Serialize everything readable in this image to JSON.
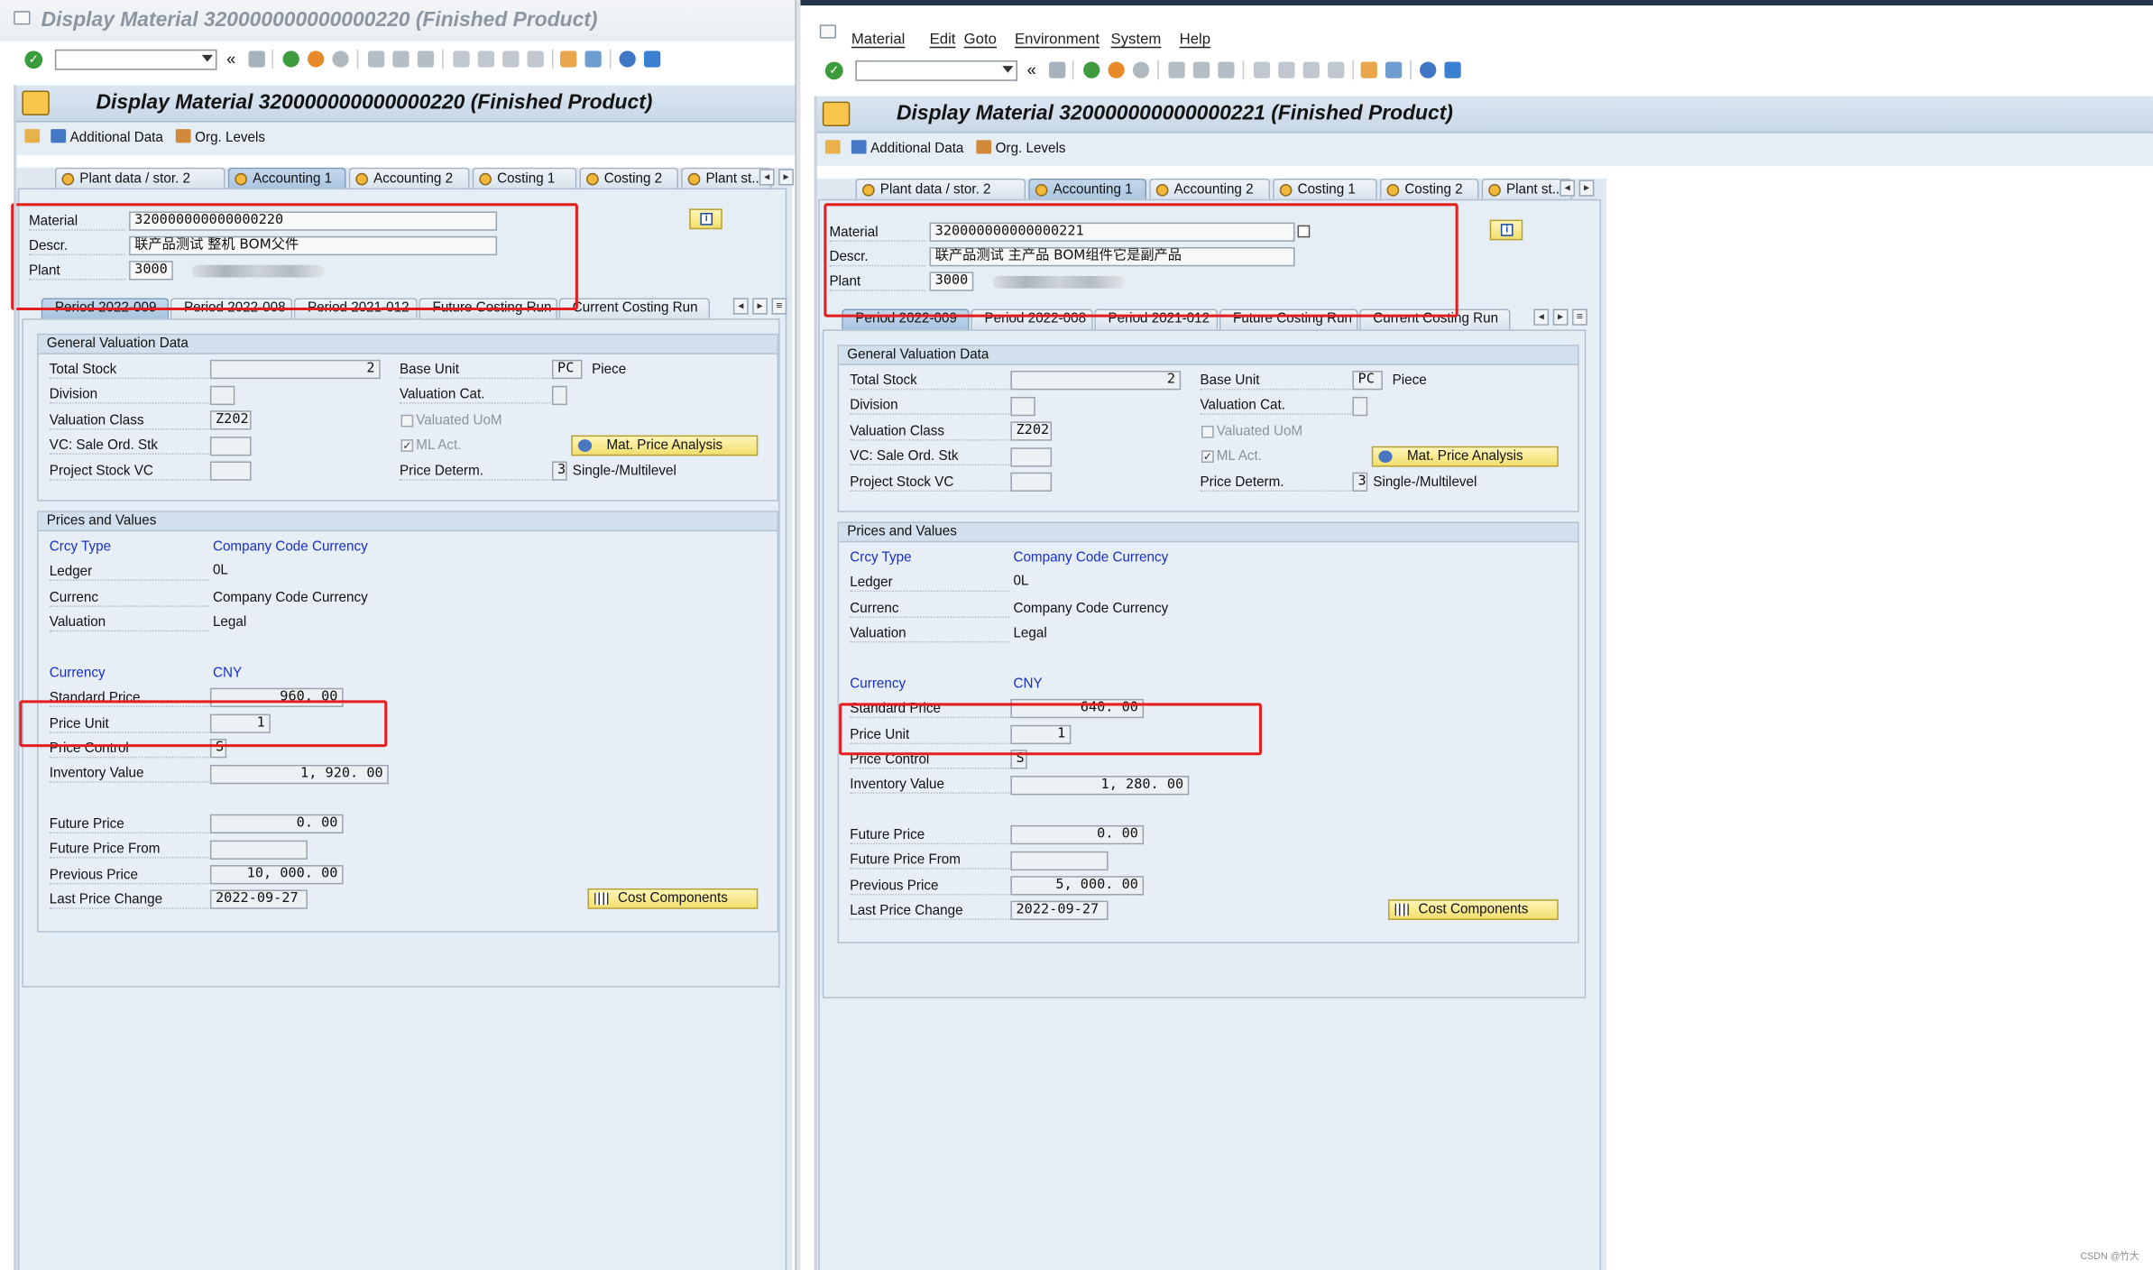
{
  "windows": [
    {
      "window_title": "Display Material 320000000000000220 (Finished Product)",
      "header_title": "Display Material 320000000000000220 (Finished Product)",
      "app_toolbar": {
        "additional_data": "Additional Data",
        "org_levels": "Org. Levels"
      },
      "tabs": [
        "Plant data / stor. 2",
        "Accounting 1",
        "Accounting 2",
        "Costing 1",
        "Costing 2",
        "Plant st..."
      ],
      "active_tab": "Accounting 1",
      "fields": {
        "material_label": "Material",
        "material": "320000000000000220",
        "descr_label": "Descr.",
        "descr": "联产品测试 整机 BOM父件",
        "plant_label": "Plant",
        "plant": "3000"
      },
      "period_tabs": [
        "Period 2022-009",
        "Period 2022-008",
        "Period 2021-012",
        "Future Costing Run",
        "Current Costing Run"
      ],
      "general": {
        "title": "General Valuation Data",
        "total_stock_label": "Total Stock",
        "total_stock": "2",
        "base_unit_label": "Base Unit",
        "base_unit": "PC",
        "base_unit_text": "Piece",
        "division_label": "Division",
        "division": "",
        "valuation_cat_label": "Valuation Cat.",
        "valuation_cat": "",
        "valuation_class_label": "Valuation Class",
        "valuation_class": "Z202",
        "valuated_uom_label": "Valuated UoM",
        "vc_sale_label": "VC: Sale Ord. Stk",
        "vc_sale": "",
        "ml_act_label": "ML Act.",
        "mat_price_btn": "Mat. Price Analysis",
        "project_stock_label": "Project Stock VC",
        "project_stock": "",
        "price_determ_label": "Price Determ.",
        "price_determ": "3",
        "price_determ_text": "Single-/Multilevel"
      },
      "prices": {
        "title": "Prices and Values",
        "crcy_type_label": "Crcy Type",
        "crcy_type": "Company Code Currency",
        "ledger_label": "Ledger",
        "ledger": "0L",
        "currenc_label": "Currenc",
        "currenc": "Company Code Currency",
        "valuation_label": "Valuation",
        "valuation": "Legal",
        "currency_label": "Currency",
        "currency": "CNY",
        "standard_price_label": "Standard Price",
        "standard_price": "960. 00",
        "price_unit_label": "Price Unit",
        "price_unit": "1",
        "price_control_label": "Price Control",
        "price_control": "S",
        "inventory_value_label": "Inventory Value",
        "inventory_value": "1, 920. 00",
        "future_price_label": "Future Price",
        "future_price": "0. 00",
        "future_price_from_label": "Future Price From",
        "future_price_from": "",
        "previous_price_label": "Previous Price",
        "previous_price": "10, 000. 00",
        "last_price_change_label": "Last Price Change",
        "last_price_change": "2022-09-27",
        "cost_components_btn": "Cost Components"
      }
    },
    {
      "window_title": "",
      "header_title": "Display Material 320000000000000221 (Finished Product)",
      "menu": [
        "Material",
        "Edit",
        "Goto",
        "Environment",
        "System",
        "Help"
      ],
      "app_toolbar": {
        "additional_data": "Additional Data",
        "org_levels": "Org. Levels"
      },
      "tabs": [
        "Plant data / stor. 2",
        "Accounting 1",
        "Accounting 2",
        "Costing 1",
        "Costing 2",
        "Plant st..."
      ],
      "active_tab": "Accounting 1",
      "fields": {
        "material_label": "Material",
        "material": "320000000000000221",
        "descr_label": "Descr.",
        "descr": "联产品测试 主产品 BOM组件它是副产品",
        "plant_label": "Plant",
        "plant": "3000"
      },
      "period_tabs": [
        "Period 2022-009",
        "Period 2022-008",
        "Period 2021-012",
        "Future Costing Run",
        "Current Costing Run"
      ],
      "general": {
        "title": "General Valuation Data",
        "total_stock_label": "Total Stock",
        "total_stock": "2",
        "base_unit_label": "Base Unit",
        "base_unit": "PC",
        "base_unit_text": "Piece",
        "division_label": "Division",
        "division": "",
        "valuation_cat_label": "Valuation Cat.",
        "valuation_cat": "",
        "valuation_class_label": "Valuation Class",
        "valuation_class": "Z202",
        "valuated_uom_label": "Valuated UoM",
        "vc_sale_label": "VC: Sale Ord. Stk",
        "vc_sale": "",
        "ml_act_label": "ML Act.",
        "mat_price_btn": "Mat. Price Analysis",
        "project_stock_label": "Project Stock VC",
        "project_stock": "",
        "price_determ_label": "Price Determ.",
        "price_determ": "3",
        "price_determ_text": "Single-/Multilevel"
      },
      "prices": {
        "title": "Prices and Values",
        "crcy_type_label": "Crcy Type",
        "crcy_type": "Company Code Currency",
        "ledger_label": "Ledger",
        "ledger": "0L",
        "currenc_label": "Currenc",
        "currenc": "Company Code Currency",
        "valuation_label": "Valuation",
        "valuation": "Legal",
        "currency_label": "Currency",
        "currency": "CNY",
        "standard_price_label": "Standard Price",
        "standard_price": "640. 00",
        "price_unit_label": "Price Unit",
        "price_unit": "1",
        "price_control_label": "Price Control",
        "price_control": "S",
        "inventory_value_label": "Inventory Value",
        "inventory_value": "1, 280. 00",
        "future_price_label": "Future Price",
        "future_price": "0. 00",
        "future_price_from_label": "Future Price From",
        "future_price_from": "",
        "previous_price_label": "Previous Price",
        "previous_price": "5, 000. 00",
        "last_price_change_label": "Last Price Change",
        "last_price_change": "2022-09-27",
        "cost_components_btn": "Cost Components"
      }
    }
  ],
  "icons": {
    "enter": "check-icon",
    "save": "save-icon",
    "back": "back-icon",
    "exit": "exit-icon",
    "cancel": "cancel-icon",
    "print": "print-icon",
    "find": "find-icon",
    "help": "help-icon",
    "layout": "customize-layout-icon",
    "info": "info-icon"
  },
  "colors": {
    "header_bg": "#c8d7e7",
    "body_bg": "#dfe8f1",
    "highlight": "#e41e1e",
    "link_blue": "#1730c8",
    "button_yellow": "#f2df6d"
  },
  "watermark": "CSDN @竹大"
}
